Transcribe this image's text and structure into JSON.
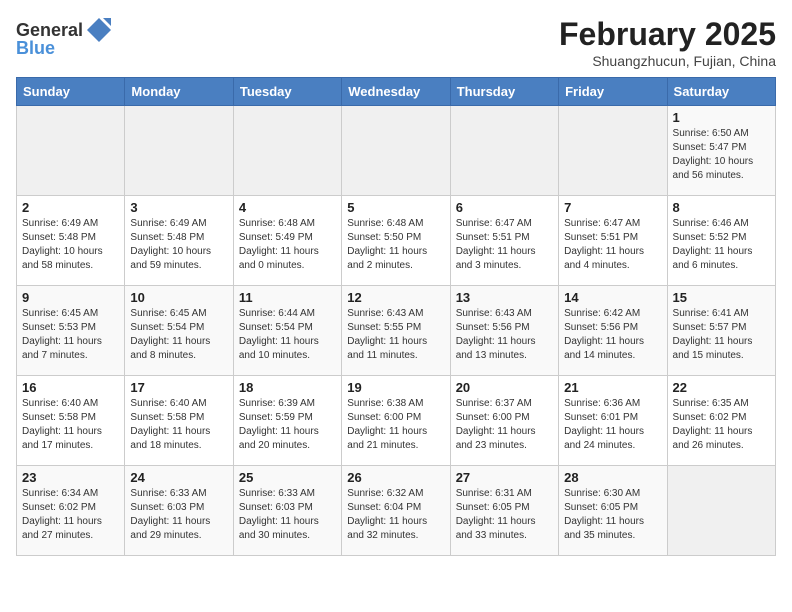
{
  "header": {
    "logo_general": "General",
    "logo_blue": "Blue",
    "month_year": "February 2025",
    "subtitle": "Shuangzhucun, Fujian, China"
  },
  "weekdays": [
    "Sunday",
    "Monday",
    "Tuesday",
    "Wednesday",
    "Thursday",
    "Friday",
    "Saturday"
  ],
  "weeks": [
    [
      {
        "day": "",
        "info": ""
      },
      {
        "day": "",
        "info": ""
      },
      {
        "day": "",
        "info": ""
      },
      {
        "day": "",
        "info": ""
      },
      {
        "day": "",
        "info": ""
      },
      {
        "day": "",
        "info": ""
      },
      {
        "day": "1",
        "info": "Sunrise: 6:50 AM\nSunset: 5:47 PM\nDaylight: 10 hours and 56 minutes."
      }
    ],
    [
      {
        "day": "2",
        "info": "Sunrise: 6:49 AM\nSunset: 5:48 PM\nDaylight: 10 hours and 58 minutes."
      },
      {
        "day": "3",
        "info": "Sunrise: 6:49 AM\nSunset: 5:48 PM\nDaylight: 10 hours and 59 minutes."
      },
      {
        "day": "4",
        "info": "Sunrise: 6:48 AM\nSunset: 5:49 PM\nDaylight: 11 hours and 0 minutes."
      },
      {
        "day": "5",
        "info": "Sunrise: 6:48 AM\nSunset: 5:50 PM\nDaylight: 11 hours and 2 minutes."
      },
      {
        "day": "6",
        "info": "Sunrise: 6:47 AM\nSunset: 5:51 PM\nDaylight: 11 hours and 3 minutes."
      },
      {
        "day": "7",
        "info": "Sunrise: 6:47 AM\nSunset: 5:51 PM\nDaylight: 11 hours and 4 minutes."
      },
      {
        "day": "8",
        "info": "Sunrise: 6:46 AM\nSunset: 5:52 PM\nDaylight: 11 hours and 6 minutes."
      }
    ],
    [
      {
        "day": "9",
        "info": "Sunrise: 6:45 AM\nSunset: 5:53 PM\nDaylight: 11 hours and 7 minutes."
      },
      {
        "day": "10",
        "info": "Sunrise: 6:45 AM\nSunset: 5:54 PM\nDaylight: 11 hours and 8 minutes."
      },
      {
        "day": "11",
        "info": "Sunrise: 6:44 AM\nSunset: 5:54 PM\nDaylight: 11 hours and 10 minutes."
      },
      {
        "day": "12",
        "info": "Sunrise: 6:43 AM\nSunset: 5:55 PM\nDaylight: 11 hours and 11 minutes."
      },
      {
        "day": "13",
        "info": "Sunrise: 6:43 AM\nSunset: 5:56 PM\nDaylight: 11 hours and 13 minutes."
      },
      {
        "day": "14",
        "info": "Sunrise: 6:42 AM\nSunset: 5:56 PM\nDaylight: 11 hours and 14 minutes."
      },
      {
        "day": "15",
        "info": "Sunrise: 6:41 AM\nSunset: 5:57 PM\nDaylight: 11 hours and 15 minutes."
      }
    ],
    [
      {
        "day": "16",
        "info": "Sunrise: 6:40 AM\nSunset: 5:58 PM\nDaylight: 11 hours and 17 minutes."
      },
      {
        "day": "17",
        "info": "Sunrise: 6:40 AM\nSunset: 5:58 PM\nDaylight: 11 hours and 18 minutes."
      },
      {
        "day": "18",
        "info": "Sunrise: 6:39 AM\nSunset: 5:59 PM\nDaylight: 11 hours and 20 minutes."
      },
      {
        "day": "19",
        "info": "Sunrise: 6:38 AM\nSunset: 6:00 PM\nDaylight: 11 hours and 21 minutes."
      },
      {
        "day": "20",
        "info": "Sunrise: 6:37 AM\nSunset: 6:00 PM\nDaylight: 11 hours and 23 minutes."
      },
      {
        "day": "21",
        "info": "Sunrise: 6:36 AM\nSunset: 6:01 PM\nDaylight: 11 hours and 24 minutes."
      },
      {
        "day": "22",
        "info": "Sunrise: 6:35 AM\nSunset: 6:02 PM\nDaylight: 11 hours and 26 minutes."
      }
    ],
    [
      {
        "day": "23",
        "info": "Sunrise: 6:34 AM\nSunset: 6:02 PM\nDaylight: 11 hours and 27 minutes."
      },
      {
        "day": "24",
        "info": "Sunrise: 6:33 AM\nSunset: 6:03 PM\nDaylight: 11 hours and 29 minutes."
      },
      {
        "day": "25",
        "info": "Sunrise: 6:33 AM\nSunset: 6:03 PM\nDaylight: 11 hours and 30 minutes."
      },
      {
        "day": "26",
        "info": "Sunrise: 6:32 AM\nSunset: 6:04 PM\nDaylight: 11 hours and 32 minutes."
      },
      {
        "day": "27",
        "info": "Sunrise: 6:31 AM\nSunset: 6:05 PM\nDaylight: 11 hours and 33 minutes."
      },
      {
        "day": "28",
        "info": "Sunrise: 6:30 AM\nSunset: 6:05 PM\nDaylight: 11 hours and 35 minutes."
      },
      {
        "day": "",
        "info": ""
      }
    ]
  ]
}
